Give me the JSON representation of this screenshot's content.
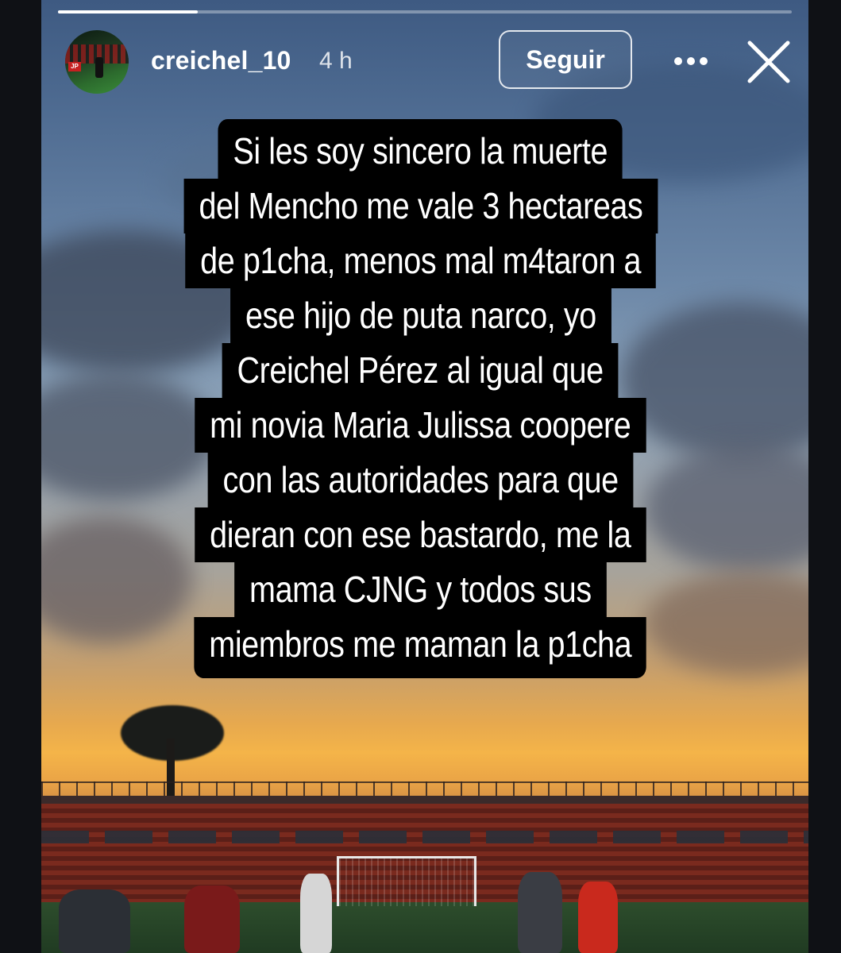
{
  "story": {
    "progress": 0.19,
    "username": "creichel_10",
    "time": "4 h",
    "follow_label": "Seguir",
    "more_icon": "more-dots-icon",
    "close_icon": "close-icon"
  },
  "caption": {
    "lines": [
      "Si les soy sincero la muerte",
      "del Mencho me vale 3 hectareas",
      "de p1cha, menos mal m4taron a",
      "ese hijo de puta narco, yo",
      "Creichel Pérez al igual que",
      "mi novia Maria Julissa coopere",
      "con las autoridades para que",
      "dieran con ese bastardo, me la",
      "mama CJNG y todos sus",
      "miembros me maman la p1cha"
    ]
  },
  "colors": {
    "caption_bg": "#000000",
    "caption_text": "#ffffff",
    "header_text": "#ffffff"
  }
}
